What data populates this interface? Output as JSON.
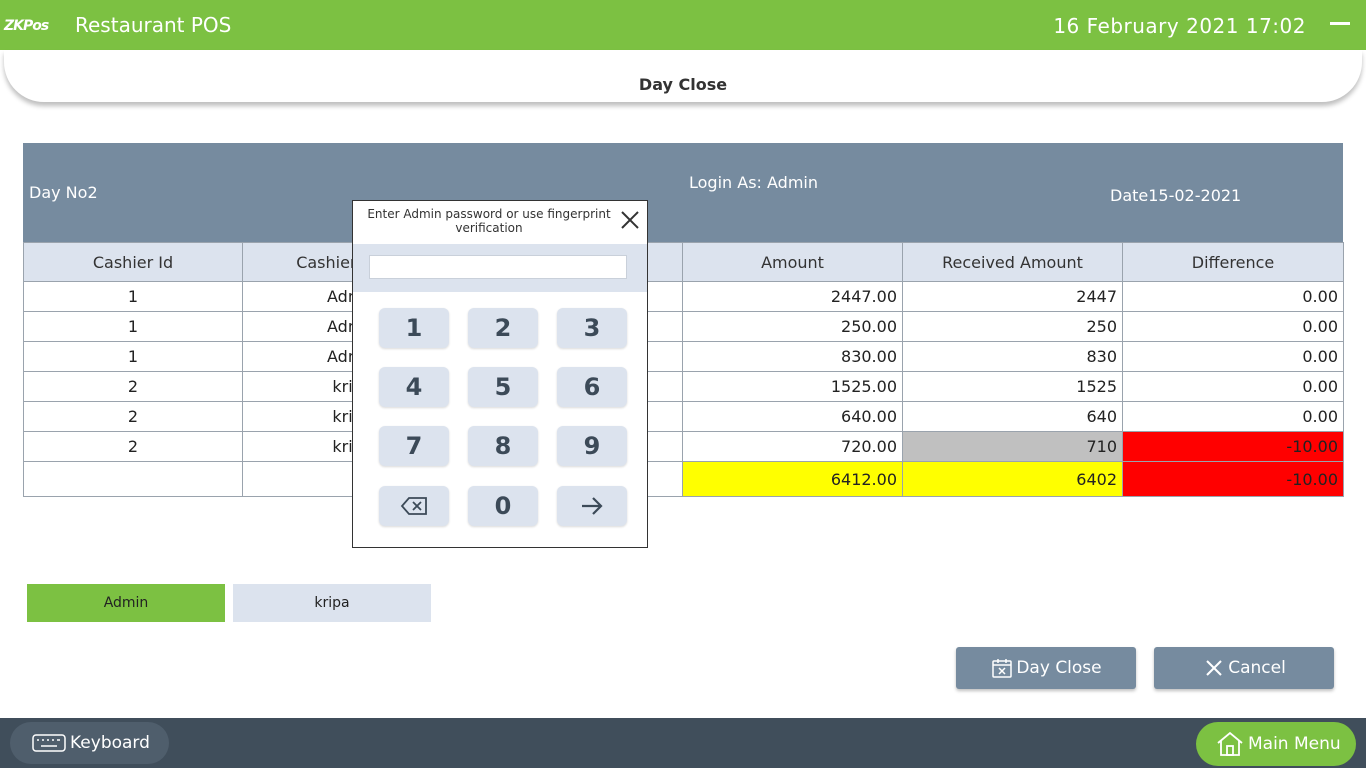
{
  "header": {
    "logo_main": "ZK",
    "logo_sub": "Pos",
    "app_title": "Restaurant POS",
    "datetime": "16 February 2021 17:02"
  },
  "page_title": "Day Close",
  "info": {
    "day_no": "Day No2",
    "login_as": "Login As:  Admin",
    "date": "Date15-02-2021"
  },
  "table": {
    "columns": [
      "Cashier Id",
      "Cashier Name",
      "",
      "Amount",
      "Received Amount",
      "Difference"
    ],
    "rows": [
      {
        "cashier_id": "1",
        "cashier_name": "Admin",
        "amount": "2447.00",
        "received": "2447",
        "difference": "0.00"
      },
      {
        "cashier_id": "1",
        "cashier_name": "Admin",
        "amount": "250.00",
        "received": "250",
        "difference": "0.00"
      },
      {
        "cashier_id": "1",
        "cashier_name": "Admin",
        "amount": "830.00",
        "received": "830",
        "difference": "0.00"
      },
      {
        "cashier_id": "2",
        "cashier_name": "kripa",
        "amount": "1525.00",
        "received": "1525",
        "difference": "0.00"
      },
      {
        "cashier_id": "2",
        "cashier_name": "kripa",
        "amount": "640.00",
        "received": "640",
        "difference": "0.00"
      },
      {
        "cashier_id": "2",
        "cashier_name": "kripa",
        "amount": "720.00",
        "received": "710",
        "difference": "-10.00"
      }
    ],
    "total": {
      "amount": "6412.00",
      "received": "6402",
      "difference": "-10.00"
    }
  },
  "cashier_tabs": [
    "Admin",
    "kripa"
  ],
  "buttons": {
    "day_close": "Day Close",
    "cancel": "Cancel",
    "keyboard": "Keyboard",
    "main_menu": "Main Menu"
  },
  "modal": {
    "message_line1": "Enter Admin password or use fingerprint",
    "message_line2": "verification",
    "password_value": "",
    "keys": [
      "1",
      "2",
      "3",
      "4",
      "5",
      "6",
      "7",
      "8",
      "9",
      "backspace-icon",
      "0",
      "enter-arrow-icon"
    ],
    "key_labels": {
      "1": "1",
      "2": "2",
      "3": "3",
      "4": "4",
      "5": "5",
      "6": "6",
      "7": "7",
      "8": "8",
      "9": "9",
      "0": "0"
    }
  },
  "colors": {
    "brand_green": "#7cc142",
    "slate": "#768b9f",
    "footer": "#404e5b",
    "highlight_yellow": "#ffff00",
    "highlight_red": "#ff0000",
    "grey_cell": "#c0c0c0"
  }
}
